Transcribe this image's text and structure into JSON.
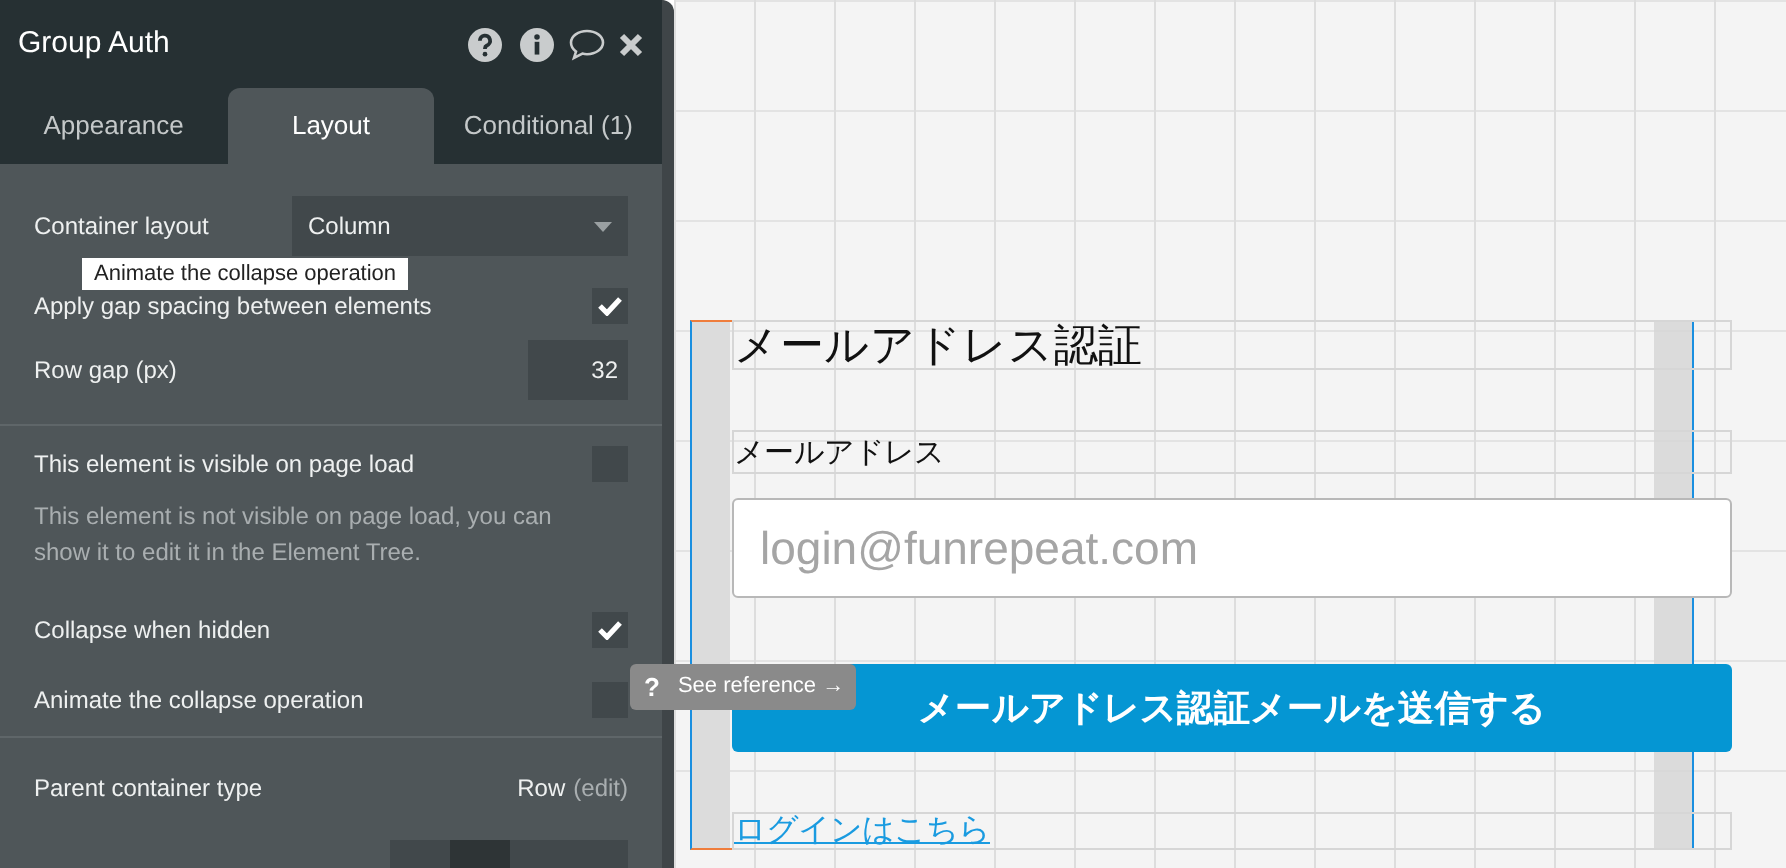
{
  "panel": {
    "title": "Group Auth",
    "tabs": [
      {
        "label": "Appearance",
        "selected": false
      },
      {
        "label": "Layout",
        "selected": true
      },
      {
        "label": "Conditional (1)",
        "selected": false
      }
    ],
    "rows": [
      {
        "kind": "dropdown",
        "label": "Container layout",
        "value": "Column"
      },
      {
        "kind": "checkbox",
        "label": "Apply gap spacing between elements",
        "checked": true
      },
      {
        "kind": "number",
        "label": "Row gap (px)",
        "value": "32"
      },
      {
        "kind": "divider"
      },
      {
        "kind": "checkbox",
        "label": "This element is visible on page load",
        "checked": false
      },
      {
        "kind": "note",
        "label": "This element is not visible on page load, you can show it to edit it in the Element Tree."
      },
      {
        "kind": "checkbox",
        "label": "Collapse when hidden",
        "checked": true
      },
      {
        "kind": "checkbox",
        "label": "Animate the collapse operation",
        "checked": false
      },
      {
        "kind": "divider"
      },
      {
        "kind": "value",
        "label": "Parent container type",
        "value": "Row",
        "link": "(edit)"
      },
      {
        "kind": "segmented"
      }
    ],
    "tooltip": "Animate the collapse operation"
  },
  "canvas": {
    "title": "メールアドレス認証",
    "field_label": "メールアドレス",
    "email_field": {
      "placeholder": "login@funrepeat.com"
    },
    "submit_button": "メールアドレス認証メールを送信する",
    "login_link": "ログインはこちら"
  },
  "reference_tip": {
    "icon": "?",
    "text": "See reference →"
  }
}
